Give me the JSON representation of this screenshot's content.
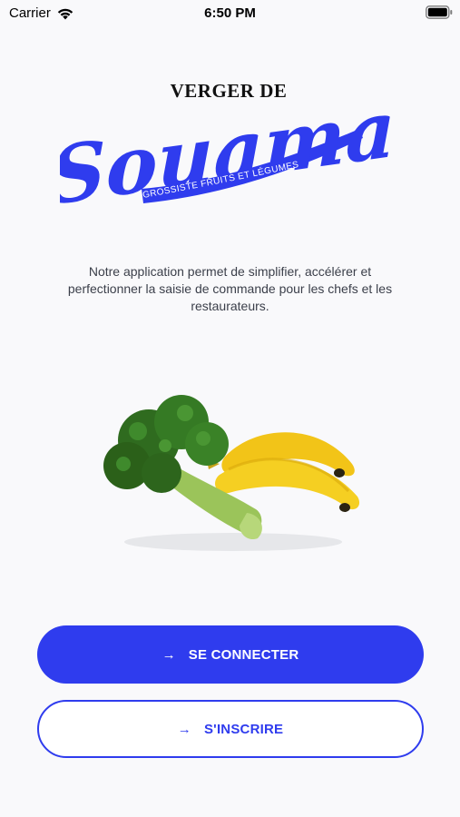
{
  "status_bar": {
    "carrier": "Carrier",
    "time": "6:50 PM",
    "wifi_icon": "wifi-icon",
    "battery_icon": "battery-full-icon"
  },
  "logo": {
    "line1": "VERGER DE",
    "line2": "Souama",
    "tagline": "GROSSISTE FRUITS ET LÉGUMES",
    "color": "#2f3cee"
  },
  "description": "Notre application permet de simplifier, accélérer et perfectionner la saisie de commande pour les chefs et les restaurateurs.",
  "illustration": {
    "items": [
      "broccoli",
      "bananas"
    ]
  },
  "buttons": {
    "connect_label": "SE CONNECTER",
    "register_label": "S'INSCRIRE",
    "arrow_icon": "arrow-right-icon",
    "primary_color": "#2f3cee"
  }
}
